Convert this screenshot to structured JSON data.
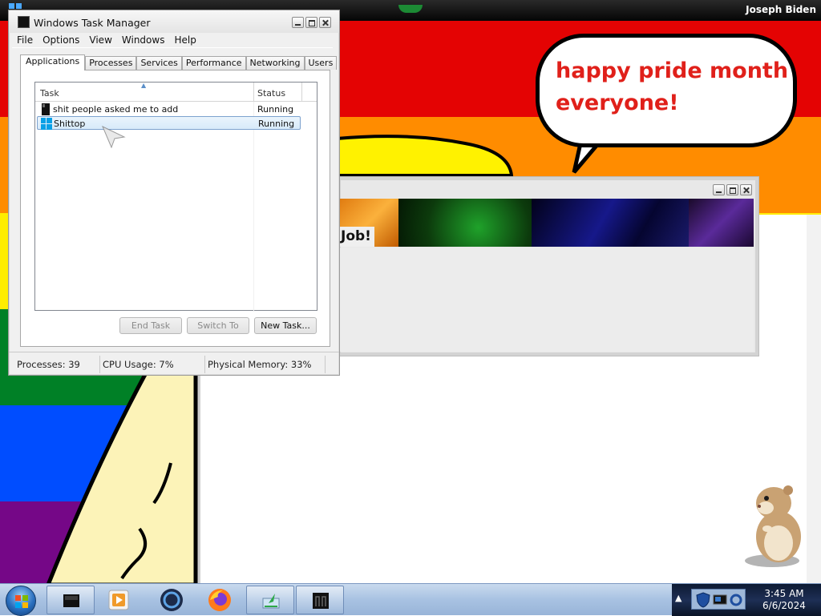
{
  "desktop": {
    "user_name": "Joseph Biden",
    "bubble_text_line1": "happy pride month",
    "bubble_text_line2": "everyone!",
    "flag_colors": [
      "#e40303",
      "#ff8c00",
      "#ffed00",
      "#008026",
      "#004dff",
      "#750787"
    ]
  },
  "task_manager": {
    "title": "Windows Task Manager",
    "menu": [
      "File",
      "Options",
      "View",
      "Windows",
      "Help"
    ],
    "tabs": [
      "Applications",
      "Processes",
      "Services",
      "Performance",
      "Networking",
      "Users"
    ],
    "active_tab": "Applications",
    "columns": {
      "task": "Task",
      "status": "Status"
    },
    "tasks": [
      {
        "name": "shit people asked me to add",
        "status": "Running",
        "icon": "black-app-icon"
      },
      {
        "name": "Shittop",
        "status": "Running",
        "icon": "blue-windows-icon"
      }
    ],
    "buttons": {
      "end_task": "End Task",
      "switch_to": "Switch To",
      "new_task": "New Task..."
    },
    "status": {
      "processes": "Processes: 39",
      "cpu": "CPU Usage: 7%",
      "memory": "Physical Memory: 33%"
    }
  },
  "second_window": {
    "banner_text": "Job!"
  },
  "taskbar": {
    "clock_time": "3:45 AM",
    "clock_date": "6/6/2024",
    "pinned": [
      "dark-monitor-icon",
      "media-player-icon",
      "globe-icon",
      "firefox-icon",
      "green-app-icon",
      "dark-app-icon"
    ]
  }
}
